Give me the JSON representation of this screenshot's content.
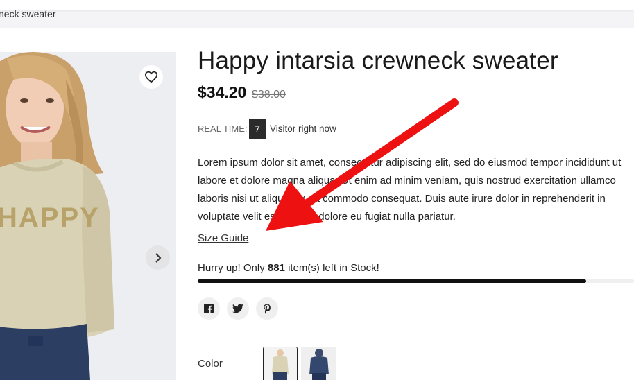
{
  "breadcrumb": {
    "current": "neck sweater"
  },
  "product": {
    "title": "Happy intarsia crewneck sweater",
    "price": "$34.20",
    "old_price": "$38.00",
    "realtime_label": "REAL TIME:",
    "visitor_count": "7",
    "visitor_text": "Visitor right now",
    "description": "Lorem ipsum dolor sit amet, consectetur adipiscing elit, sed do eiusmod tempor incididunt ut labore et dolore magna aliqua. Ut enim ad minim veniam, quis nostrud exercitation ullamco laboris nisi ut aliquip ex ea commodo consequat. Duis aute irure dolor in reprehenderit in voluptate velit esse cillum dolore eu fugiat nulla pariatur.",
    "size_guide": "Size Guide",
    "stock_prefix": "Hurry up! Only",
    "stock_count": "881",
    "stock_suffix": "item(s) left in Stock!",
    "stock_progress_fraction": 0.89,
    "color_label": "Color",
    "graphic_text": "HAPPY"
  },
  "icons": {
    "wishlist": "heart-icon",
    "next": "chevron-right-icon",
    "facebook": "facebook-icon",
    "twitter": "twitter-icon",
    "pinterest": "pinterest-icon"
  },
  "colors": {
    "annotation_arrow": "#ee1111",
    "sweater": "#d9d2b4",
    "jeans": "#2c3f63",
    "gallery_bg": "#edeef2"
  }
}
